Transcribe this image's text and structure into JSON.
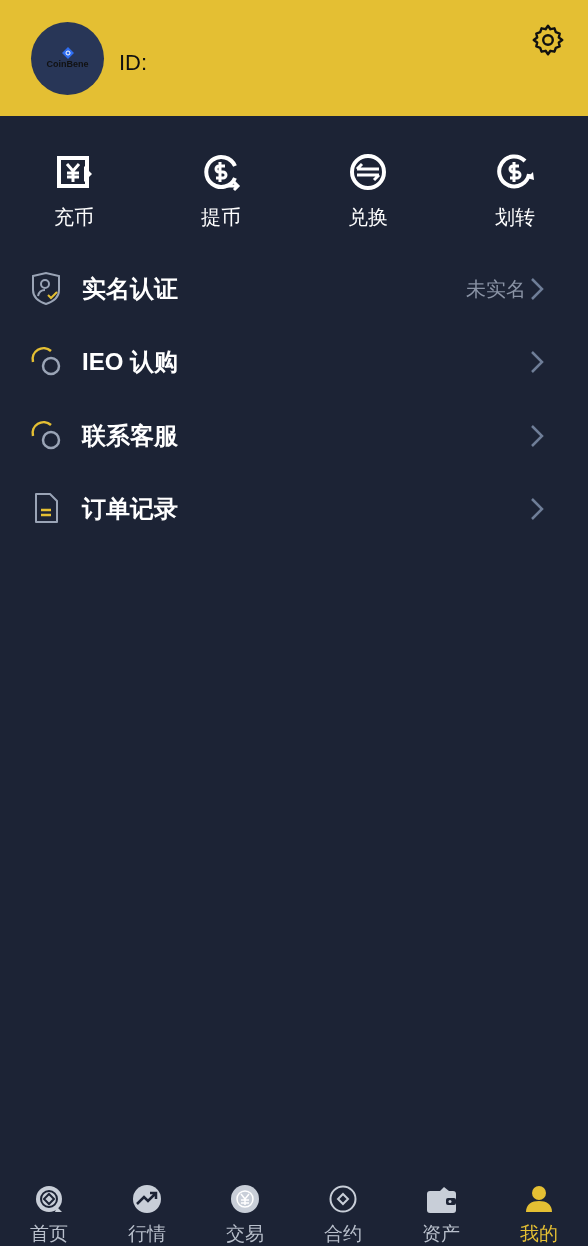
{
  "profile": {
    "avatar_logo": "CoinBene",
    "id_label": "ID:"
  },
  "actions": [
    {
      "kind": "deposit",
      "label": "充币"
    },
    {
      "kind": "withdraw",
      "label": "提币"
    },
    {
      "kind": "exchange",
      "label": "兑换"
    },
    {
      "kind": "transfer",
      "label": "划转"
    }
  ],
  "menu": [
    {
      "kind": "verify",
      "label": "实名认证",
      "status": "未实名"
    },
    {
      "kind": "ring",
      "label": "IEO 认购"
    },
    {
      "kind": "ring",
      "label": "联系客服"
    },
    {
      "kind": "doc",
      "label": "订单记录"
    }
  ],
  "tabs": [
    {
      "kind": "home",
      "label": "首页",
      "selected": false
    },
    {
      "kind": "market",
      "label": "行情",
      "selected": false
    },
    {
      "kind": "trade",
      "label": "交易",
      "selected": false
    },
    {
      "kind": "contract",
      "label": "合约",
      "selected": false
    },
    {
      "kind": "assets",
      "label": "资产",
      "selected": false
    },
    {
      "kind": "me",
      "label": "我的",
      "selected": true
    }
  ]
}
